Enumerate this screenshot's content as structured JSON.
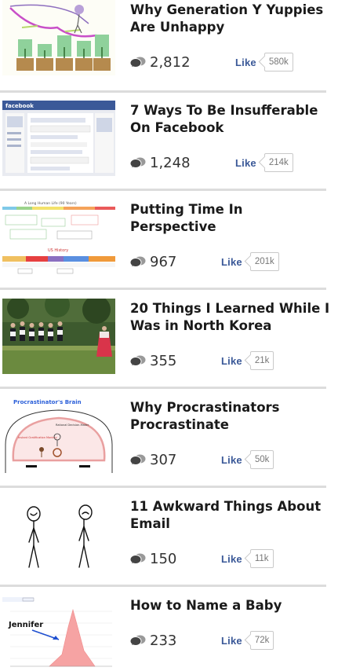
{
  "articles": [
    {
      "title": "Why Generation Y Yuppies Are Unhappy",
      "comments": "2,812",
      "like_label": "Like",
      "like_count": "580k",
      "thumb_icon": "gen-y-cartoon"
    },
    {
      "title": "7 Ways To Be Insufferable On Facebook",
      "comments": "1,248",
      "like_label": "Like",
      "like_count": "214k",
      "thumb_icon": "facebook-screenshot",
      "thumb_logo": "facebook"
    },
    {
      "title": "Putting Time In Perspective",
      "comments": "967",
      "like_label": "Like",
      "like_count": "201k",
      "thumb_icon": "timeline-chart",
      "thumb_text_1": "A Long Human Life (90 Years)",
      "thumb_text_2": "US History"
    },
    {
      "title": "20 Things I Learned While I Was in North Korea",
      "comments": "355",
      "like_label": "Like",
      "like_count": "21k",
      "thumb_icon": "north-korea-photo"
    },
    {
      "title": "Why Procrastinators Procrastinate",
      "comments": "307",
      "like_label": "Like",
      "like_count": "50k",
      "thumb_icon": "procrastinator-brain",
      "thumb_text_1": "Procrastinator's Brain",
      "thumb_text_2": "Rational Decision-Maker",
      "thumb_text_3": "Instant Gratification Monkey"
    },
    {
      "title": "11 Awkward Things About Email",
      "comments": "150",
      "like_label": "Like",
      "like_count": "11k",
      "thumb_icon": "stick-figures"
    },
    {
      "title": "How to Name a Baby",
      "comments": "233",
      "like_label": "Like",
      "like_count": "72k",
      "thumb_icon": "name-popularity-chart",
      "thumb_text_1": "Jennifer"
    }
  ],
  "colors": {
    "title": "#1a1a1a",
    "meta_text": "#333333",
    "like_blue": "#3b5998",
    "divider": "#dcdcdc"
  }
}
